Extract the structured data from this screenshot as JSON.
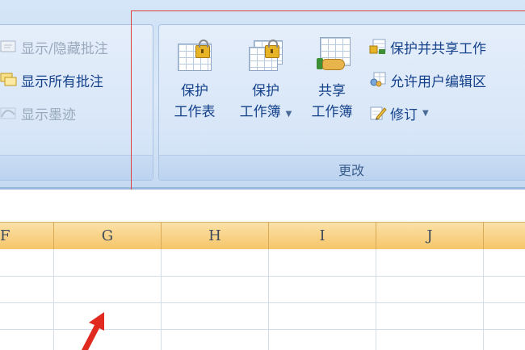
{
  "review_group_left": {
    "items": [
      {
        "label": "显示/隐藏批注",
        "icon": "comment-toggle-icon",
        "enabled": false
      },
      {
        "label": "显示所有批注",
        "icon": "comments-icon",
        "enabled": true
      },
      {
        "label": "显示墨迹",
        "icon": "ink-icon",
        "enabled": false
      }
    ]
  },
  "changes_group": {
    "caption": "更改",
    "protect_sheet": {
      "line1": "保护",
      "line2": "工作表",
      "icon": "protect-sheet-icon"
    },
    "protect_workbook": {
      "line1": "保护",
      "line2": "工作簿",
      "icon": "protect-workbook-icon"
    },
    "share_workbook": {
      "line1": "共享",
      "line2": "工作簿",
      "icon": "share-workbook-icon"
    },
    "small_items": [
      {
        "label": "保护并共享工作",
        "icon": "protect-share-icon"
      },
      {
        "label": "允许用户编辑区",
        "icon": "allow-edit-ranges-icon"
      },
      {
        "label": "修订",
        "icon": "track-changes-icon"
      }
    ]
  },
  "columns": [
    "F",
    "G",
    "H",
    "I",
    "J",
    ""
  ],
  "colors": {
    "highlight_border": "#e0403c",
    "arrow": "#e02a20",
    "ribbon_text": "#15428b",
    "header_fill": "#f6c66a"
  }
}
